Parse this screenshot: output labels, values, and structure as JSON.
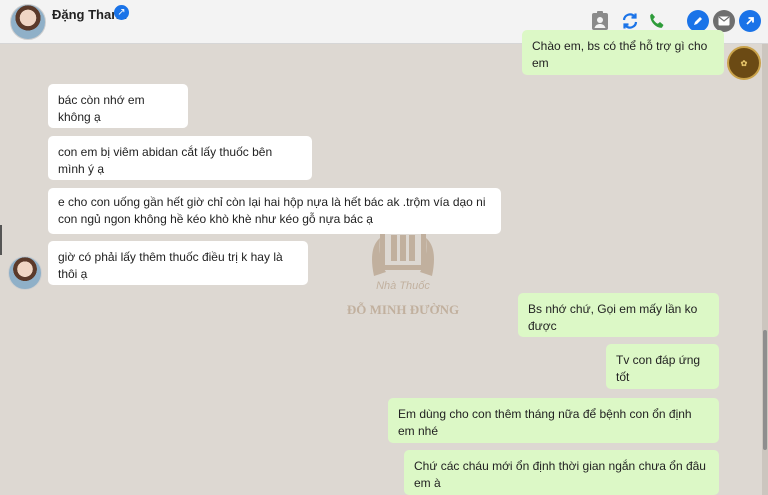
{
  "header": {
    "contact_name": "Đặng Thanh",
    "verified_icon": "verified-badge-icon",
    "icons": [
      "contact-card-icon",
      "sync-icon",
      "phone-icon",
      "edit-icon",
      "mail-icon",
      "open-link-icon"
    ]
  },
  "colors": {
    "sent_bubble": "#dcf8c6",
    "received_bubble": "#ffffff",
    "chat_background": "#ddd8d2",
    "accent_blue": "#1a73e8",
    "phone_green": "#2e9c3a"
  },
  "watermark": {
    "subtitle": "Nhà Thuốc",
    "name": "ĐỖ MINH ĐƯỜNG"
  },
  "messages": [
    {
      "direction": "sent",
      "text": "Chào em, bs có thể hỗ trợ gì cho em"
    },
    {
      "direction": "received",
      "text": "bác còn nhớ em không ạ"
    },
    {
      "direction": "received",
      "text": "con em bị viêm abidan cắt lấy thuốc bên mình ý ạ"
    },
    {
      "direction": "received",
      "text": "e cho con uống gần hết giờ chỉ còn lại hai hộp nựa là hết bác ak .trộm vía dạo ni con ngủ ngon không hề kéo khò khè như kéo gỗ nựa bác ạ"
    },
    {
      "direction": "received",
      "text": "giờ có phải lấy thêm thuốc điều trị k hay là thôi ạ"
    },
    {
      "direction": "sent",
      "text": "Bs nhớ chứ, Gọi em mấy lần ko được"
    },
    {
      "direction": "sent",
      "text": "Tv con đáp ứng tốt"
    },
    {
      "direction": "sent",
      "text": "Em dùng cho con thêm tháng nữa để bệnh con ổn định em nhé"
    },
    {
      "direction": "sent",
      "text": "Chứ các cháu mới ổn định thời gian ngắn chưa ổn đâu em à"
    }
  ]
}
